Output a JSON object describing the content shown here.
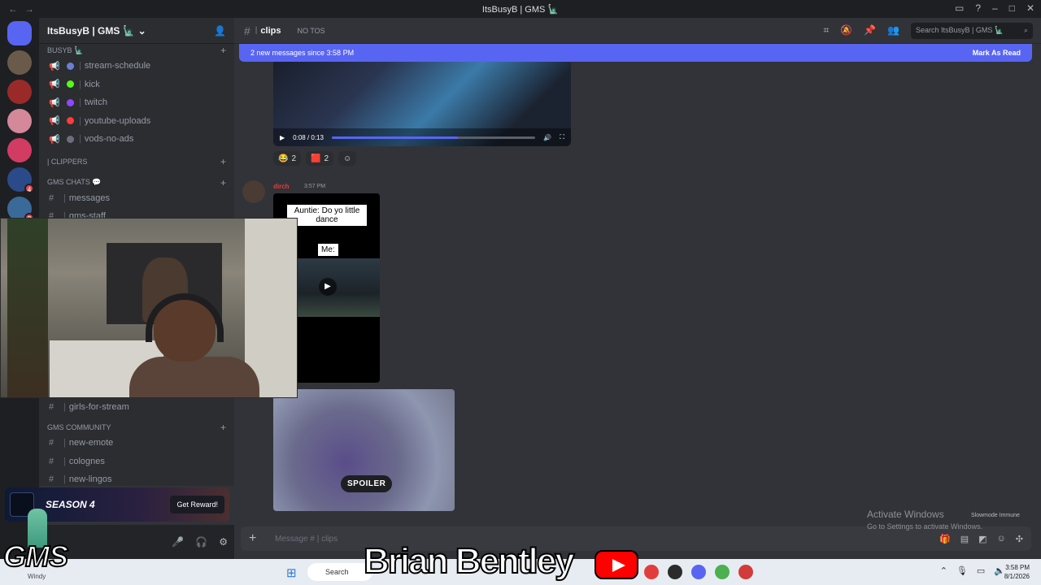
{
  "window": {
    "title": "ItsBusyB | GMS 🗽"
  },
  "server": {
    "name": "ItsBusyB | GMS 🗽"
  },
  "sidebar": {
    "categories": [
      {
        "name": "BUSYB 🗽"
      },
      {
        "name": "| CLIPPERS"
      },
      {
        "name": "GMS CHATS 💬"
      },
      {
        "name": "GMS COMMUNITY"
      }
    ],
    "channels_top": [
      {
        "label": "stream-schedule",
        "color": "#6b7fd6"
      },
      {
        "label": "kick",
        "color": "#53fc18"
      },
      {
        "label": "twitch",
        "color": "#9146ff"
      },
      {
        "label": "youtube-uploads",
        "color": "#ff3b3b"
      },
      {
        "label": "vods-no-ads",
        "color": "#6b6f7b"
      }
    ],
    "channels_chats": [
      {
        "label": "messages"
      },
      {
        "label": "gms-staff"
      }
    ],
    "channels_lower": [
      {
        "label": "girls-for-stream"
      },
      {
        "label": "new-emote"
      },
      {
        "label": "colognes"
      },
      {
        "label": "new-lingos"
      }
    ]
  },
  "promo": {
    "title": "SEASON 4",
    "button": "Get Reward!"
  },
  "channel": {
    "name": "clips",
    "topic": "NO TOS",
    "search_placeholder": "Search ItsBusyB | GMS 🗽"
  },
  "banner": {
    "text": "2 new messages since 3:58 PM",
    "action": "Mark As Read"
  },
  "video1": {
    "time": "0:08 / 0:13",
    "progress": 0.62
  },
  "reactions": [
    {
      "emoji": "😂",
      "count": "2"
    },
    {
      "emoji": "🟥",
      "count": "2"
    }
  ],
  "message2": {
    "author": "dirch",
    "time": "3:57 PM",
    "caption1": "Auntie: Do yo little dance",
    "caption2": "Me:"
  },
  "spoiler": {
    "label": "SPOILER"
  },
  "composer": {
    "placeholder": "Message # | clips"
  },
  "windows": {
    "activate_title": "Activate Windows",
    "activate_sub": "Go to Settings to activate Windows.",
    "slowmode": "Slowmode Immune"
  },
  "taskbar": {
    "weather": "Windy",
    "search": "Search",
    "time": "3:58 PM",
    "date": "8/1/2026"
  },
  "overlay": {
    "brand": "Brian Bentley",
    "logo": "GMS"
  },
  "colors": {
    "accent": "#5865f2",
    "bg": "#313338",
    "sidebar": "#2b2d31"
  }
}
